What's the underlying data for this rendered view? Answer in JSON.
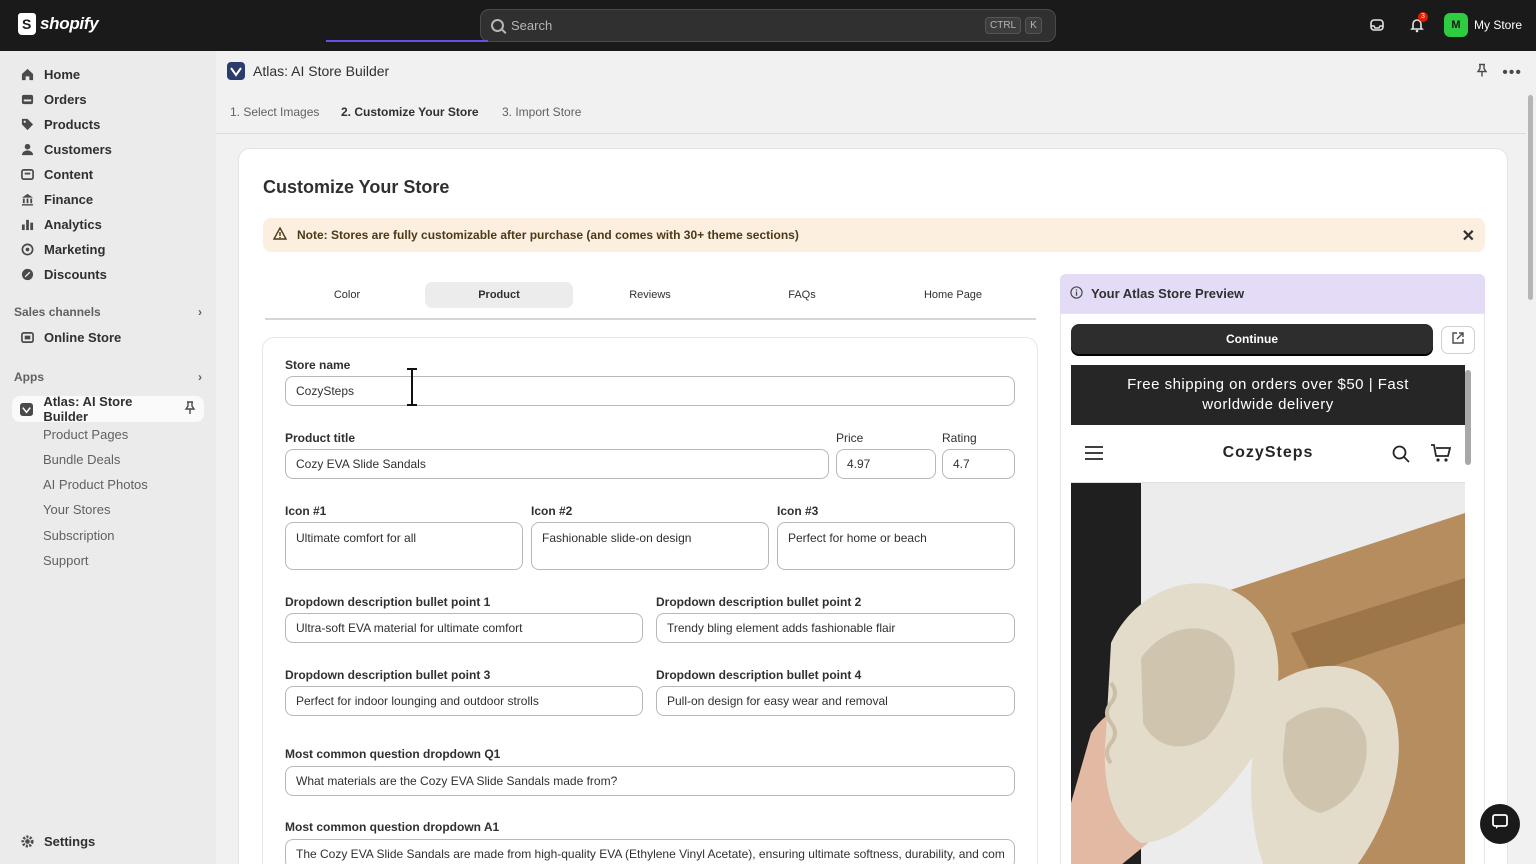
{
  "topbar": {
    "logo_text": "shopify",
    "search_placeholder": "Search",
    "kbd_ctrl": "CTRL",
    "kbd_k": "K",
    "notification_count": "3",
    "avatar_initials": "M",
    "store_name": "My Store"
  },
  "sidebar": {
    "nav": [
      {
        "label": "Home",
        "icon": "home-icon"
      },
      {
        "label": "Orders",
        "icon": "orders-icon"
      },
      {
        "label": "Products",
        "icon": "tag-icon"
      },
      {
        "label": "Customers",
        "icon": "person-icon"
      },
      {
        "label": "Content",
        "icon": "content-icon"
      },
      {
        "label": "Finance",
        "icon": "bank-icon"
      },
      {
        "label": "Analytics",
        "icon": "bar-chart-icon"
      },
      {
        "label": "Marketing",
        "icon": "target-icon"
      },
      {
        "label": "Discounts",
        "icon": "discount-icon"
      }
    ],
    "sales_channels_label": "Sales channels",
    "online_store_label": "Online Store",
    "apps_label": "Apps",
    "app_label": "Atlas: AI Store Builder",
    "app_sub_items": [
      "Product Pages",
      "Bundle Deals",
      "AI Product Photos",
      "Your Stores",
      "Subscription",
      "Support"
    ],
    "settings_label": "Settings"
  },
  "app_header": {
    "title": "Atlas: AI Store Builder"
  },
  "steps": [
    "1. Select Images",
    "2. Customize Your Store",
    "3. Import Store"
  ],
  "card": {
    "title": "Customize Your Store",
    "note": "Note: Stores are fully customizable after purchase (and comes with 30+ theme sections)"
  },
  "tabs": [
    "Color",
    "Product",
    "Reviews",
    "FAQs",
    "Home Page"
  ],
  "form": {
    "store_name_label": "Store name",
    "store_name_value": "CozySteps",
    "product_title_label": "Product title",
    "product_title_value": "Cozy EVA Slide Sandals",
    "price_label": "Price",
    "price_value": "4.97",
    "rating_label": "Rating",
    "rating_value": "4.7",
    "icon1_label": "Icon #1",
    "icon1_value": "Ultimate comfort for all",
    "icon2_label": "Icon #2",
    "icon2_value": "Fashionable slide-on design",
    "icon3_label": "Icon #3",
    "icon3_value": "Perfect for home or beach",
    "bp1_label": "Dropdown description bullet point 1",
    "bp1_value": "Ultra-soft EVA material for ultimate comfort",
    "bp2_label": "Dropdown description bullet point 2",
    "bp2_value": "Trendy bling element adds fashionable flair",
    "bp3_label": "Dropdown description bullet point 3",
    "bp3_value": "Perfect for indoor lounging and outdoor strolls",
    "bp4_label": "Dropdown description bullet point 4",
    "bp4_value": "Pull-on design for easy wear and removal",
    "q1_label": "Most common question dropdown Q1",
    "q1_value": "What materials are the Cozy EVA Slide Sandals made from?",
    "a1_label": "Most common question dropdown A1",
    "a1_value": "The Cozy EVA Slide Sandals are made from high-quality EVA (Ethylene Vinyl Acetate), ensuring ultimate softness, durability, and comfort f"
  },
  "preview": {
    "heading": "Your Atlas Store Preview",
    "continue_label": "Continue",
    "banner_line1": "Free shipping on orders over $50 | Fast",
    "banner_line2": "worldwide delivery",
    "store_name": "CozySteps"
  },
  "colors": {
    "accent": "#6c4de6",
    "topbar": "#1a1a1a",
    "note_bg": "#fcefdf",
    "preview_header": "#e4dcf7"
  }
}
